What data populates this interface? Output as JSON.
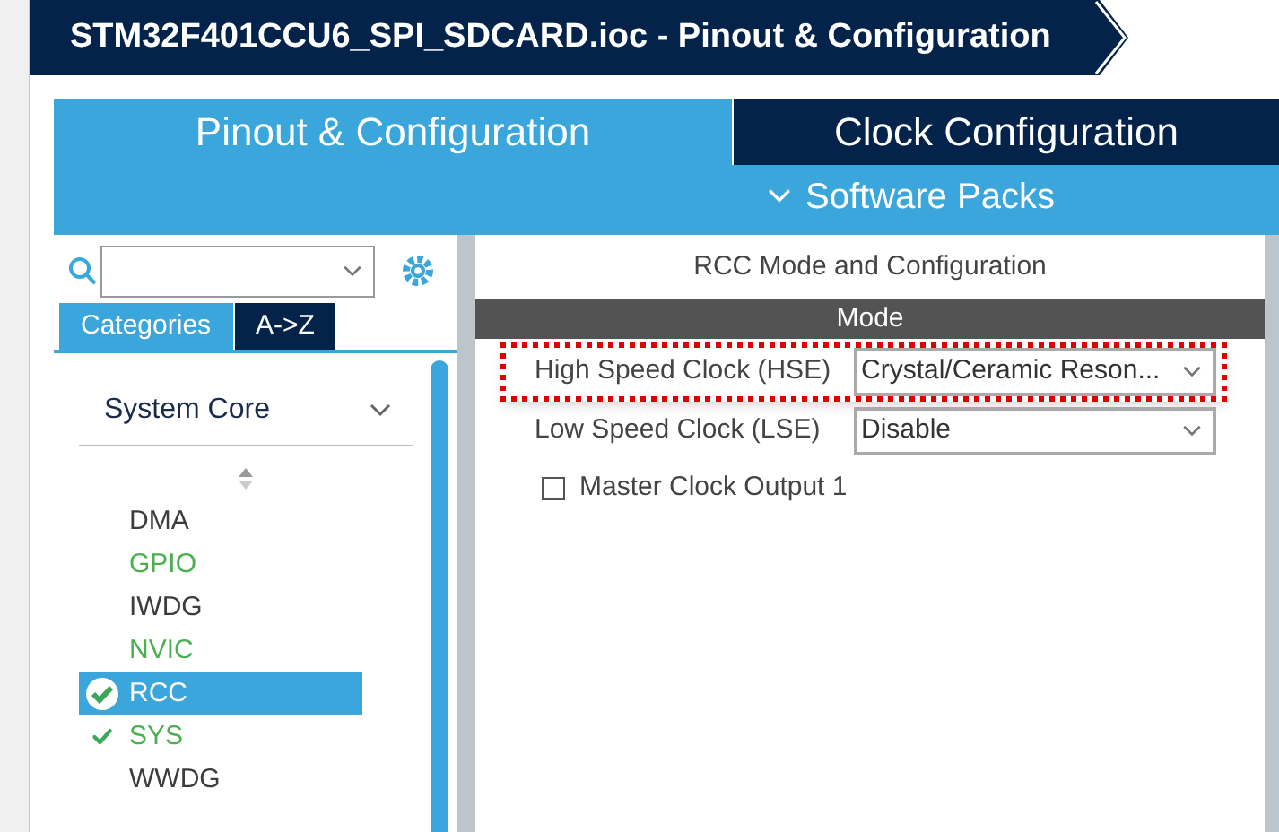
{
  "window": {
    "title": "STM32F401CCU6_SPI_SDCARD.ioc - Pinout & Configuration"
  },
  "tabs": [
    {
      "label": "Pinout & Configuration",
      "selected": true
    },
    {
      "label": "Clock Configuration",
      "selected": false
    }
  ],
  "software_packs": {
    "label": "Software Packs"
  },
  "sidebar": {
    "view_tabs": [
      {
        "label": "Categories",
        "selected": true
      },
      {
        "label": "A->Z",
        "selected": false
      }
    ],
    "category": {
      "label": "System Core",
      "expanded": true
    },
    "items": [
      {
        "label": "DMA",
        "color": "#3c3c3c",
        "checked": false,
        "selected": false
      },
      {
        "label": "GPIO",
        "color": "#4caf50",
        "checked": false,
        "selected": false
      },
      {
        "label": "IWDG",
        "color": "#3c3c3c",
        "checked": false,
        "selected": false
      },
      {
        "label": "NVIC",
        "color": "#4caf50",
        "checked": false,
        "selected": false
      },
      {
        "label": "RCC",
        "checked": true,
        "selected": true
      },
      {
        "label": "SYS",
        "color": "#4caf50",
        "checked": true,
        "selected": false
      },
      {
        "label": "WWDG",
        "color": "#3c3c3c",
        "checked": false,
        "selected": false
      }
    ]
  },
  "panel": {
    "title": "RCC Mode and Configuration",
    "section": "Mode",
    "fields": [
      {
        "kind": "select",
        "label": "High Speed Clock (HSE)",
        "value": "Crystal/Ceramic Reson...",
        "highlighted": true
      },
      {
        "kind": "select",
        "label": "Low Speed Clock (LSE)",
        "value": "Disable",
        "highlighted": false
      },
      {
        "kind": "checkbox",
        "label": "Master Clock Output 1",
        "checked": false
      }
    ]
  }
}
